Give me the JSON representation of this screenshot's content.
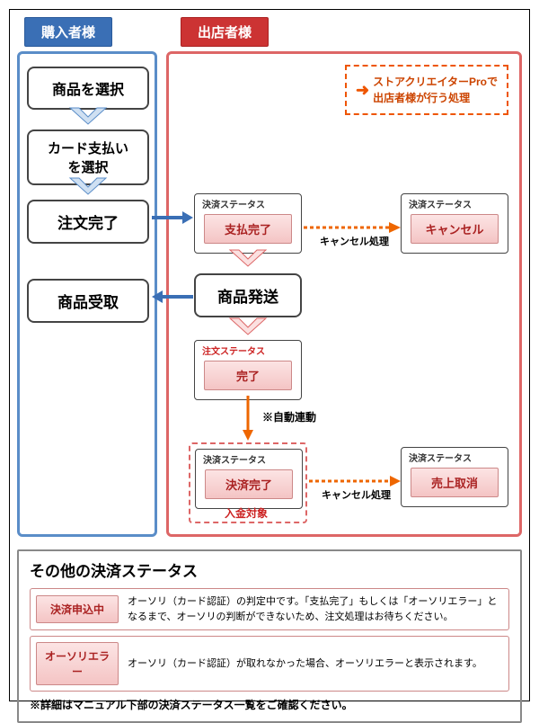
{
  "titles": {
    "buyer": "購入者様",
    "seller": "出店者様"
  },
  "legend": {
    "text": "ストアクリエイターProで\n出店者様が行う処理"
  },
  "buyer_steps": [
    "商品を選択",
    "カード支払い\nを選択",
    "注文完了",
    "商品受取"
  ],
  "seller": {
    "pay_frame_label": "決済ステータス",
    "pay_done": "支払完了",
    "cancel_frame_label": "決済ステータス",
    "cancel": "キャンセル",
    "cancel_text": "キャンセル処理",
    "ship": "商品発送",
    "order_frame_label": "注文ステータス",
    "order_done": "完了",
    "auto_link": "※自動連動",
    "settle_frame_label": "決済ステータス",
    "settle_done": "決済完了",
    "deposit_note": "入金対象",
    "cancel_text2": "キャンセル処理",
    "revoke_frame_label": "決済ステータス",
    "revoke": "売上取消"
  },
  "footer": {
    "title": "その他の決済ステータス",
    "rows": [
      {
        "btn": "決済申込中",
        "desc": "オーソリ（カード認証）の判定中です。「支払完了」もしくは「オーソリエラー」となるまで、オーソリの判断ができないため、注文処理はお待ちください。"
      },
      {
        "btn": "オーソリエラー",
        "desc": "オーソリ（カード認証）が取れなかった場合、オーソリエラーと表示されます。"
      }
    ],
    "note": "※詳細はマニュアル下部の決済ステータス一覧をご確認ください。"
  }
}
